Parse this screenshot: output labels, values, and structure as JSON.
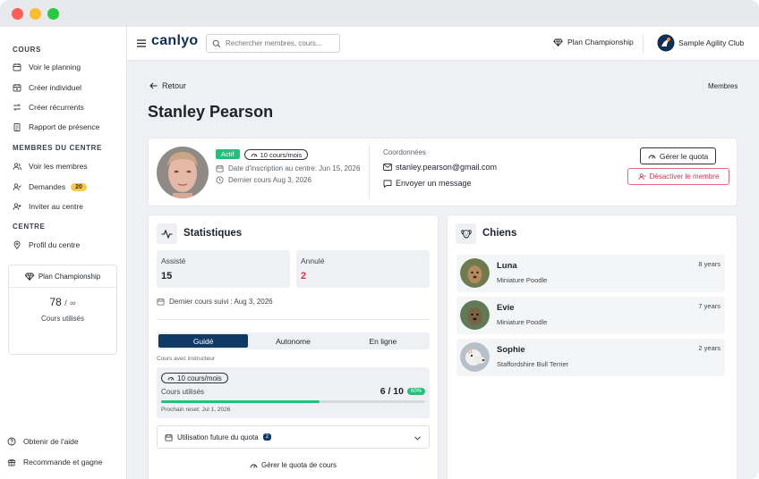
{
  "window": {
    "dots": [
      "#ff5f57",
      "#febc2e",
      "#28c840"
    ]
  },
  "sidebar": {
    "section_cours": "COURS",
    "items_cours": [
      {
        "label": "Voir le planning",
        "icon": "calendar-icon"
      },
      {
        "label": "Créer individuel",
        "icon": "calendar-plus-icon"
      },
      {
        "label": "Créer récurrents",
        "icon": "repeat-icon"
      },
      {
        "label": "Rapport de présence",
        "icon": "clipboard-icon"
      }
    ],
    "section_membres": "MEMBRES DU CENTRE",
    "items_membres": [
      {
        "label": "Voir les membres",
        "icon": "users-icon"
      },
      {
        "label": "Demandes",
        "icon": "user-check-icon",
        "badge": "20"
      },
      {
        "label": "Inviter au centre",
        "icon": "user-plus-icon"
      }
    ],
    "section_centre": "CENTRE",
    "items_centre": [
      {
        "label": "Profil du centre",
        "icon": "map-pin-icon"
      }
    ],
    "plan": {
      "name": "Plan Championship",
      "count": "78",
      "sep": "/",
      "limit": "∞",
      "caption": "Cours utilisés"
    },
    "help": "Obtenir de l'aide",
    "refer": "Recommande et gagne"
  },
  "topbar": {
    "logo": "canlyo",
    "search_placeholder": "Rechercher membres, cours...",
    "plan": "Plan Championship",
    "club": "Sample Agility Club"
  },
  "page": {
    "back": "Retour",
    "breadcrumb": "Membres",
    "title": "Stanley Pearson"
  },
  "profile": {
    "status": "Actif",
    "plan_badge": "10 cours/mois",
    "joined": "Date d'inscription au centre: Jun 15, 2026",
    "last_class": "Dernier cours Aug 3, 2026",
    "contact_heading": "Coordonnées",
    "email": "stanley.pearson@gmail.com",
    "message": "Envoyer un message",
    "manage_quota": "Gérer le quota",
    "deactivate": "Désactiver le membre"
  },
  "stats": {
    "title": "Statistiques",
    "attended_label": "Assisté",
    "attended_value": "15",
    "cancelled_label": "Annulé",
    "cancelled_value": "2",
    "last_followed": "Dernier cours suivi : Aug 3, 2026",
    "tabs": [
      "Guidé",
      "Autonome",
      "En ligne"
    ],
    "active_tab": 0,
    "subcaption": "Cours avec instructeur",
    "quota_badge": "10 cours/mois",
    "used_label": "Cours utilisés",
    "used_value": "6 / 10",
    "used_pct_label": "60%",
    "used_fraction": 0.6,
    "reset": "Prochain reset: Jul 1, 2026",
    "future_label": "Utilisation future du quota",
    "future_badge": "2",
    "manage_link": "Gérer le quota de cours"
  },
  "dogs": {
    "title": "Chiens",
    "list": [
      {
        "name": "Luna",
        "breed": "Miniature Poodle",
        "age": "8 years",
        "color": "#8a6d4b"
      },
      {
        "name": "Evie",
        "breed": "Miniature Poodle",
        "age": "7 years",
        "color": "#6b5a3c"
      },
      {
        "name": "Sophie",
        "breed": "Staffordshire Bull Terrier",
        "age": "2 years",
        "color": "#c9ccd1"
      }
    ]
  },
  "colors": {
    "accent": "#0f3a66",
    "green": "#22c07a",
    "red": "#d6334d",
    "yellow": "#f7c948"
  }
}
